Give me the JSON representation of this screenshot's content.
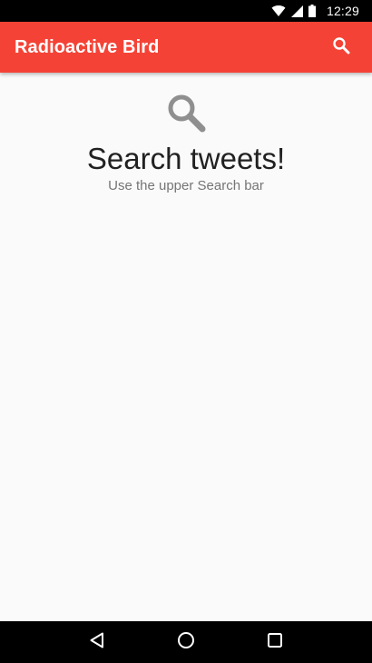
{
  "status_bar": {
    "time": "12:29",
    "icons": [
      "wifi-icon",
      "cell-signal-icon",
      "battery-icon"
    ]
  },
  "app_bar": {
    "title": "Radioactive Bird",
    "action_icon": "search-icon",
    "background_color": "#f44336"
  },
  "empty_state": {
    "icon": "search-icon",
    "title": "Search tweets!",
    "subtitle": "Use the upper Search bar"
  },
  "nav_bar": {
    "buttons": [
      "back-icon",
      "home-icon",
      "recents-icon"
    ]
  }
}
